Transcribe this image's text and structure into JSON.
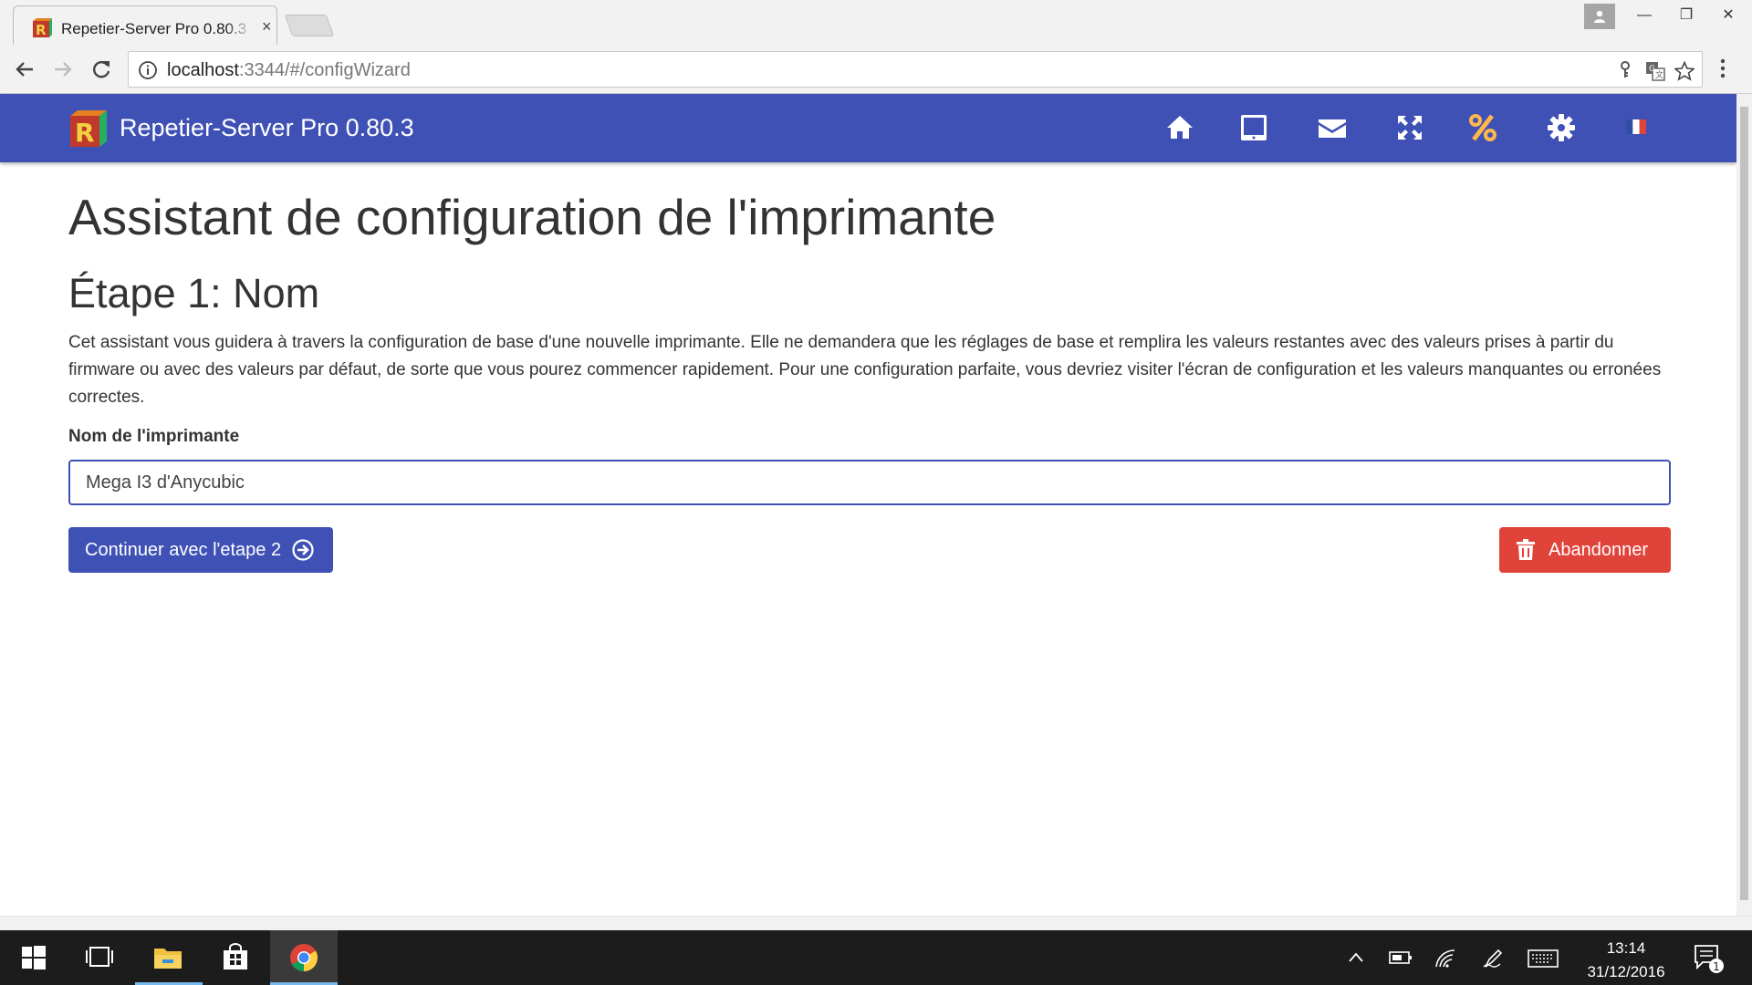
{
  "browser": {
    "tab_title": "Repetier-Server Pro 0.80.3",
    "tab_close": "×",
    "url_host": "localhost",
    "url_path": ":3344/#/configWizard",
    "window_minimize": "—",
    "window_restore": "❐",
    "window_close": "✕"
  },
  "app": {
    "title": "Repetier-Server Pro 0.80.3",
    "header_icons": [
      "home-icon",
      "tablet-icon",
      "envelope-icon",
      "expand-icon",
      "percent-icon",
      "gear-icon",
      "french-flag-icon"
    ],
    "accent_color": "#3f51b5",
    "danger_color": "#e0433a",
    "percent_color": "#ffb74d"
  },
  "wizard": {
    "page_title": "Assistant de configuration de l'imprimante",
    "step_title": "Étape 1: Nom",
    "intro": "Cet assistant vous guidera à travers la configuration de base d'une nouvelle imprimante. Elle ne demandera que les réglages de base et remplira les valeurs restantes avec des valeurs prises à partir du firmware ou avec des valeurs par défaut, de sorte que vous pourez commencer rapidement. Pour une configuration parfaite, vous devriez visiter l'écran de configuration et les valeurs manquantes ou erronées correctes.",
    "name_label": "Nom de l'imprimante",
    "name_value": "Mega I3 d'Anycubic",
    "continue_label": "Continuer avec l'etape 2",
    "abort_label": "Abandonner"
  },
  "taskbar": {
    "time": "13:14",
    "date": "31/12/2016",
    "notification_count": "1"
  }
}
